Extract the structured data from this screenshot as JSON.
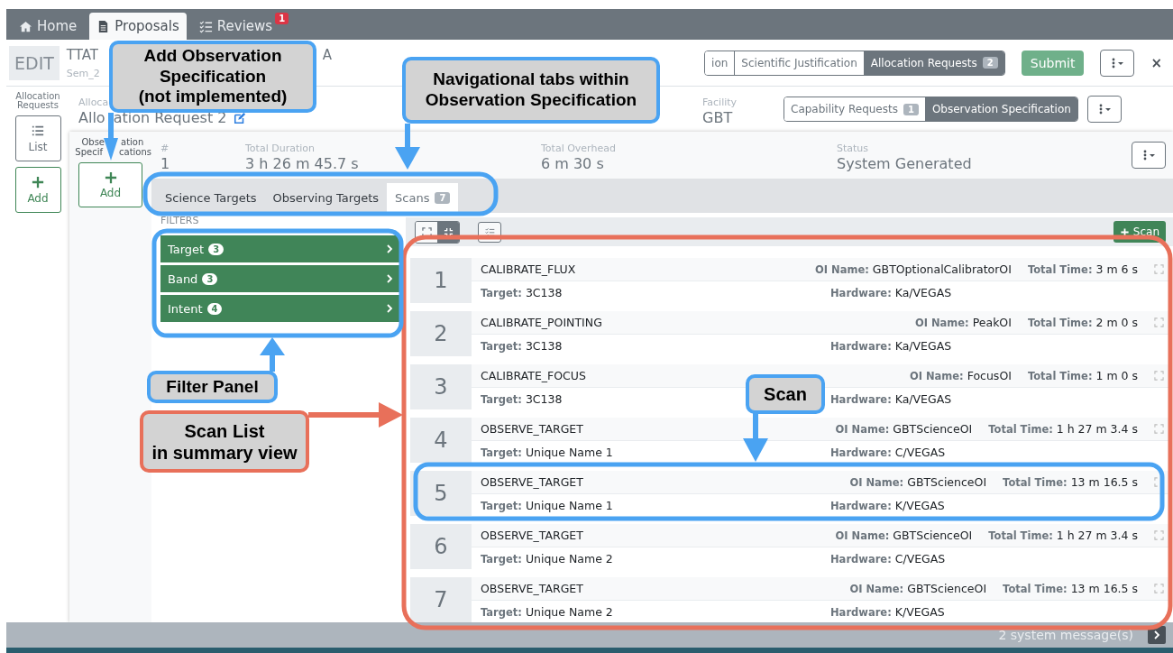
{
  "top_nav": [
    {
      "label": "Home",
      "kind": "home",
      "selected": false
    },
    {
      "label": "Proposals",
      "kind": "file",
      "selected": true
    },
    {
      "label": "Reviews",
      "kind": "checklist",
      "badge": "1",
      "selected": false
    }
  ],
  "header": {
    "mode": "EDIT",
    "title": "TTAT",
    "subtitle": "Sem_2",
    "title_tail": "A",
    "tabs": [
      {
        "label": "ion",
        "selected": false
      },
      {
        "label": "Scientific Justification",
        "selected": false
      },
      {
        "label": "Allocation Requests",
        "badge": "2",
        "selected": true
      }
    ],
    "submit": "Submit",
    "close": "×"
  },
  "sidebar": {
    "label": "Allocation Requests",
    "buttons": [
      {
        "label": "List",
        "kind": "list"
      },
      {
        "label": "Add",
        "kind": "add"
      }
    ]
  },
  "request": {
    "label": "Alloca",
    "name_parts": [
      "Allo",
      "ation Request 2"
    ],
    "facility_label": "Facility",
    "facility": "GBT",
    "tabs": [
      {
        "label": "Capability Requests",
        "badge": "1",
        "selected": false
      },
      {
        "label": "Observation Specification",
        "selected": true
      }
    ]
  },
  "spec_panel": {
    "label_lines": [
      [
        "Obse",
        "ation"
      ],
      [
        "Specif",
        "cations"
      ]
    ],
    "add": "Add"
  },
  "summary": [
    {
      "label": "#",
      "value": "1"
    },
    {
      "label": "Total Duration",
      "value": "3 h 26 m 45.7 s"
    },
    {
      "label": "Total Overhead",
      "value": "6 m 30 s"
    },
    {
      "label": "Status",
      "value": "System Generated"
    }
  ],
  "spec_tabs": [
    {
      "label": "Science Targets",
      "selected": false
    },
    {
      "label": "Observing Targets",
      "selected": false
    },
    {
      "label": "Scans",
      "badge": "7",
      "selected": true
    }
  ],
  "filters": {
    "label": "FILTERS",
    "items": [
      {
        "label": "Target",
        "count": "3"
      },
      {
        "label": "Band",
        "count": "3"
      },
      {
        "label": "Intent",
        "count": "4"
      }
    ]
  },
  "scan_toolbar": {
    "views": [
      {
        "kind": "expand",
        "selected": false
      },
      {
        "kind": "compact",
        "selected": true
      }
    ],
    "add": "Scan"
  },
  "scans": [
    {
      "number": "1",
      "name": "CALIBRATE_FLUX",
      "oi_label": "OI Name:",
      "oi": "GBTOptionalCalibratorOI",
      "time_label": "Total Time:",
      "time": "3 m 6 s",
      "target_label": "Target:",
      "target": "3C138",
      "hardware_label": "Hardware:",
      "hardware": "Ka/VEGAS"
    },
    {
      "number": "2",
      "name": "CALIBRATE_POINTING",
      "oi_label": "OI Name:",
      "oi": "PeakOI",
      "time_label": "Total Time:",
      "time": "2 m 0 s",
      "target_label": "Target:",
      "target": "3C138",
      "hardware_label": "Hardware:",
      "hardware": "Ka/VEGAS"
    },
    {
      "number": "3",
      "name": "CALIBRATE_FOCUS",
      "oi_label": "OI Name:",
      "oi": "FocusOI",
      "time_label": "Total Time:",
      "time": "1 m 0 s",
      "target_label": "Target:",
      "target": "3C138",
      "hardware_label": "Hardware:",
      "hardware": "Ka/VEGAS"
    },
    {
      "number": "4",
      "name": "OBSERVE_TARGET",
      "oi_label": "OI Name:",
      "oi": "GBTScienceOI",
      "time_label": "Total Time:",
      "time": "1 h 27 m 3.4 s",
      "target_label": "Target:",
      "target": "Unique Name 1",
      "hardware_label": "Hardware:",
      "hardware": "C/VEGAS"
    },
    {
      "number": "5",
      "name": "OBSERVE_TARGET",
      "oi_label": "OI Name:",
      "oi": "GBTScienceOI",
      "time_label": "Total Time:",
      "time": "13 m 16.5 s",
      "target_label": "Target:",
      "target": "Unique Name 1",
      "hardware_label": "Hardware:",
      "hardware": "K/VEGAS"
    },
    {
      "number": "6",
      "name": "OBSERVE_TARGET",
      "oi_label": "OI Name:",
      "oi": "GBTScienceOI",
      "time_label": "Total Time:",
      "time": "1 h 27 m 3.4 s",
      "target_label": "Target:",
      "target": "Unique Name 2",
      "hardware_label": "Hardware:",
      "hardware": "C/VEGAS"
    },
    {
      "number": "7",
      "name": "OBSERVE_TARGET",
      "oi_label": "OI Name:",
      "oi": "GBTScienceOI",
      "time_label": "Total Time:",
      "time": "13 m 16.5 s",
      "target_label": "Target:",
      "target": "Unique Name 2",
      "hardware_label": "Hardware:",
      "hardware": "K/VEGAS"
    }
  ],
  "status_bar": {
    "message": "2 system message(s)"
  },
  "annotations": [
    {
      "lines": [
        "Add Observation",
        "Specification",
        "(not implemented)"
      ],
      "color": "#4aa3f2"
    },
    {
      "lines": [
        "Navigational tabs within",
        "Observation Specification"
      ],
      "color": "#4aa3f2"
    },
    {
      "lines": [
        "Filter Panel"
      ],
      "color": "#4aa3f2"
    },
    {
      "lines": [
        "Scan List",
        "in summary view"
      ],
      "color": "#e8705a"
    },
    {
      "lines": [
        "Scan"
      ],
      "color": "#4aa3f2"
    }
  ]
}
